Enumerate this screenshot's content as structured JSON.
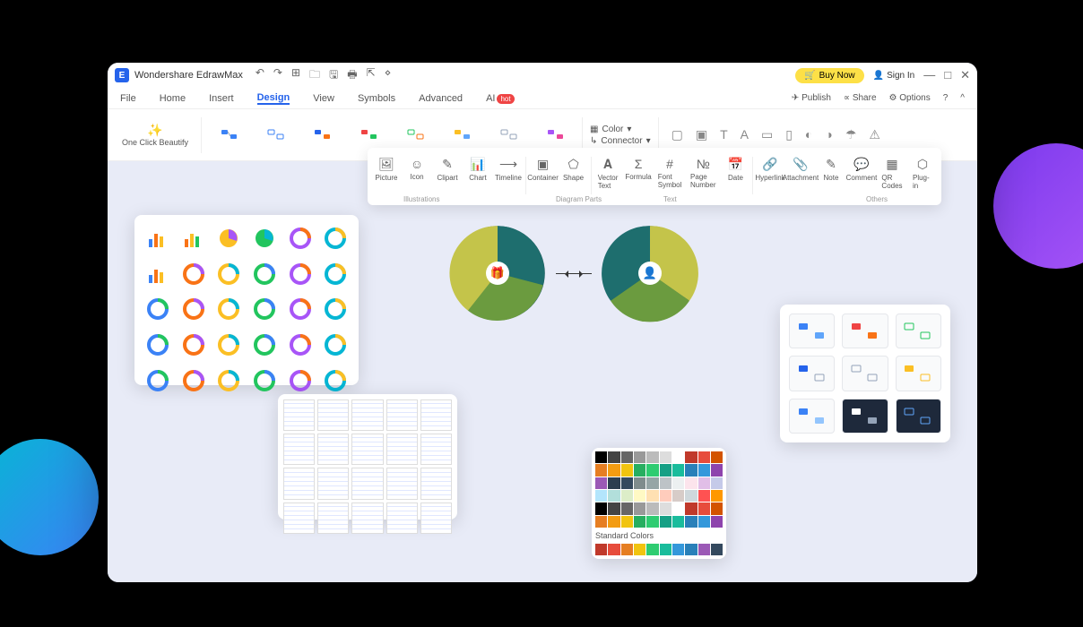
{
  "app": {
    "title": "Wondershare EdrawMax"
  },
  "titlebar": {
    "buyNow": "Buy Now",
    "signIn": "Sign In"
  },
  "menu": {
    "items": [
      "File",
      "Home",
      "Insert",
      "Design",
      "View",
      "Symbols",
      "Advanced",
      "AI"
    ],
    "active": "Design",
    "hotBadge": "hot",
    "right": {
      "publish": "Publish",
      "share": "Share",
      "options": "Options"
    }
  },
  "ribbon": {
    "oneClick": "One Click Beautify",
    "color": "Color",
    "connector": "Connector"
  },
  "toolstrip": {
    "groups": {
      "illustrations": "Illustrations",
      "diagramParts": "Diagram Parts",
      "text": "Text",
      "others": "Others"
    },
    "items": {
      "picture": "Picture",
      "icon": "Icon",
      "clipart": "Clipart",
      "chart": "Chart",
      "timeline": "Timeline",
      "container": "Container",
      "shape": "Shape",
      "vectorText": "Vector Text",
      "formula": "Formula",
      "fontSymbol": "Font Symbol",
      "pageNumber": "Page Number",
      "date": "Date",
      "hyperlink": "Hyperlink",
      "attachment": "Attachment",
      "note": "Note",
      "comment": "Comment",
      "qr": "QR Codes",
      "plugin": "Plug-in"
    }
  },
  "colorPanel": {
    "standard": "Standard Colors"
  }
}
